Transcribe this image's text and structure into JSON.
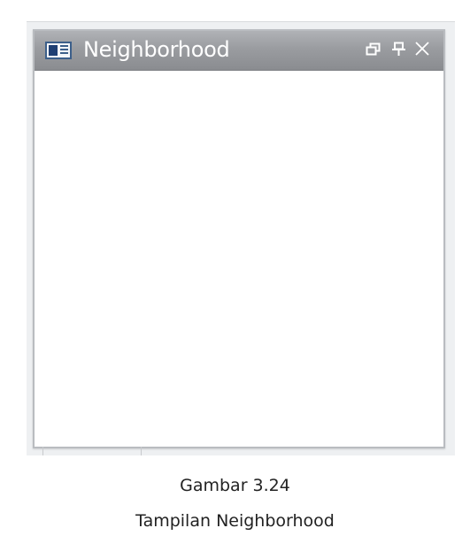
{
  "window": {
    "title": "Neighborhood",
    "icons": {
      "app": "window-list-icon",
      "dock": "restore-window-icon",
      "pin": "pin-icon",
      "close": "close-icon"
    },
    "titlebar_color": "#9a9ca0",
    "title_color": "#ffffff"
  },
  "caption": {
    "figure": "Gambar 3.24",
    "text": "Tampilan Neighborhood"
  }
}
